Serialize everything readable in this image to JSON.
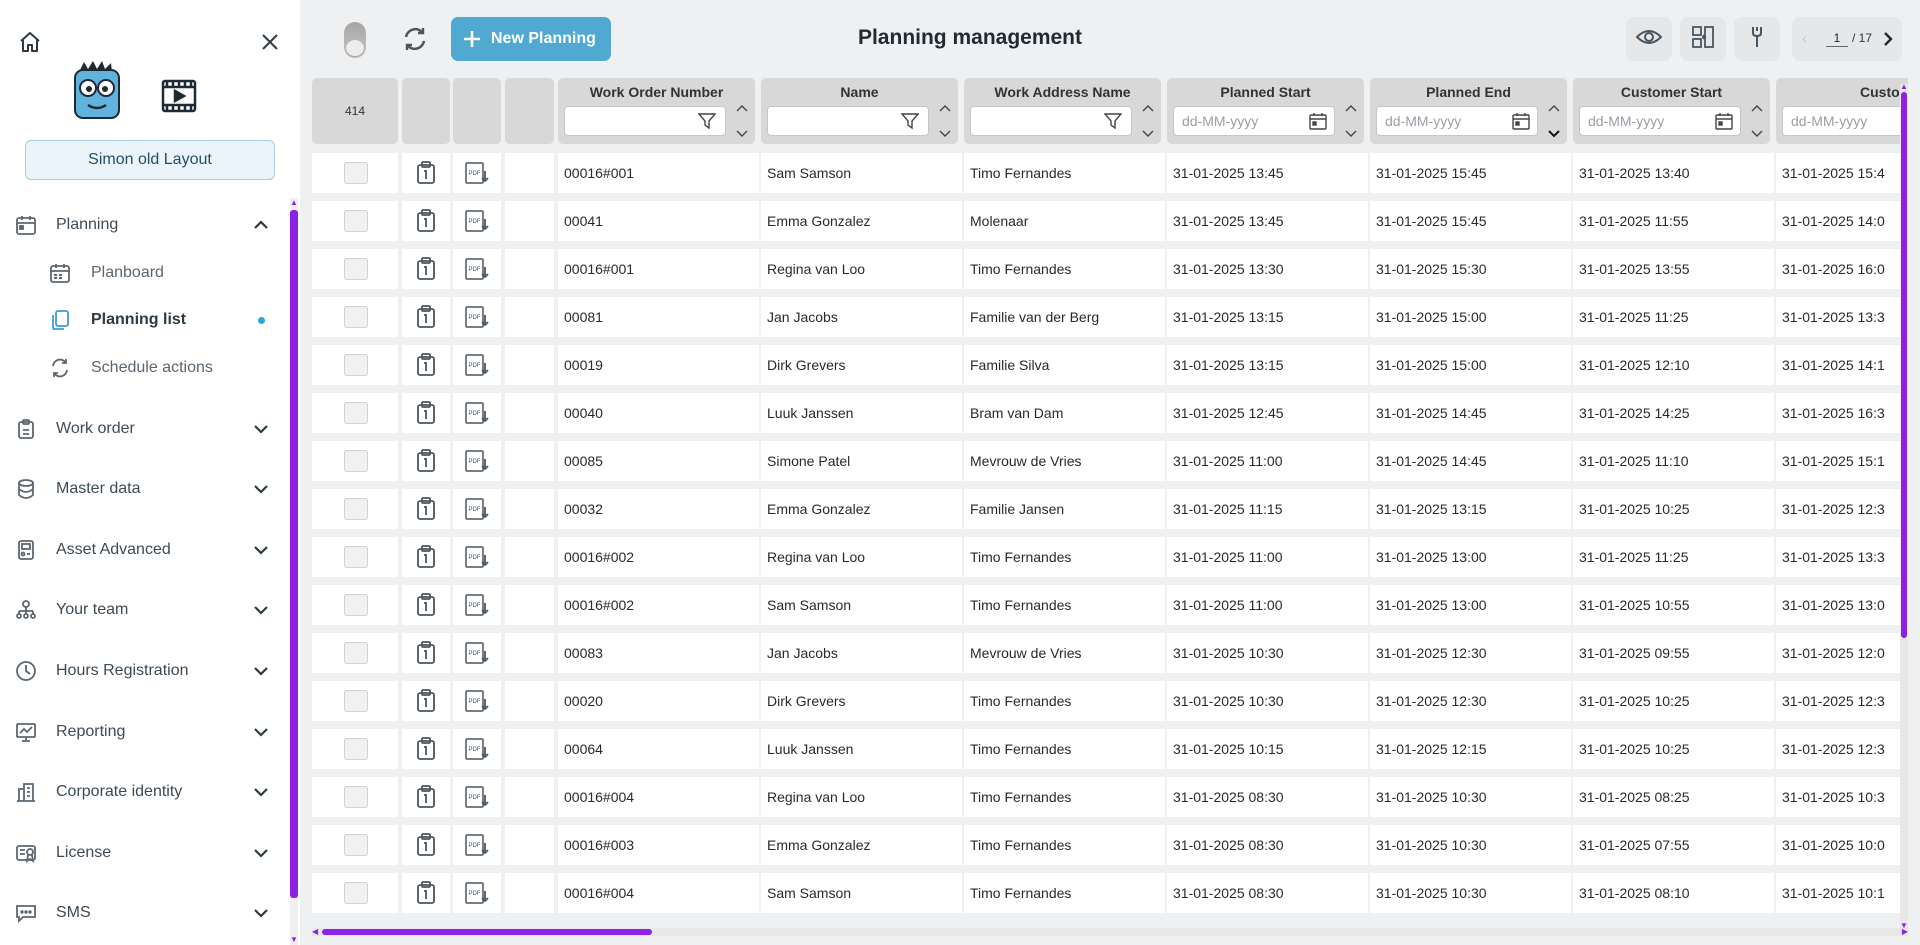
{
  "sidebar": {
    "layout_label": "Simon old Layout",
    "planning": {
      "label": "Planning"
    },
    "sub_items": [
      {
        "label": "Planboard"
      },
      {
        "label": "Planning list"
      },
      {
        "label": "Schedule actions"
      }
    ],
    "items": [
      {
        "label": "Work order",
        "icon": "clipboard-icon"
      },
      {
        "label": "Master data",
        "icon": "database-icon"
      },
      {
        "label": "Asset Advanced",
        "icon": "asset-icon"
      },
      {
        "label": "Your team",
        "icon": "team-icon"
      },
      {
        "label": "Hours Registration",
        "icon": "clock-icon"
      },
      {
        "label": "Reporting",
        "icon": "reporting-icon"
      },
      {
        "label": "Corporate identity",
        "icon": "building-icon"
      },
      {
        "label": "License",
        "icon": "license-icon"
      },
      {
        "label": "SMS",
        "icon": "sms-icon"
      }
    ]
  },
  "toolbar": {
    "new_planning_label": "New Planning",
    "title": "Planning management",
    "pager": {
      "current": "1",
      "total": "/ 17"
    }
  },
  "grid": {
    "record_count": "414",
    "columns": [
      {
        "title": "Work Order Number",
        "placeholder": ""
      },
      {
        "title": "Name",
        "placeholder": ""
      },
      {
        "title": "Work Address Name",
        "placeholder": ""
      },
      {
        "title": "Planned Start",
        "placeholder": "dd-MM-yyyy"
      },
      {
        "title": "Planned End",
        "placeholder": "dd-MM-yyyy"
      },
      {
        "title": "Customer Start",
        "placeholder": "dd-MM-yyyy"
      },
      {
        "title": "Customer",
        "placeholder": "dd-MM-yyyy"
      }
    ],
    "rows": [
      [
        "00016#001",
        "Sam Samson",
        "Timo Fernandes",
        "31-01-2025 13:45",
        "31-01-2025 15:45",
        "31-01-2025 13:40",
        "31-01-2025 15:4"
      ],
      [
        "00041",
        "Emma Gonzalez",
        "Molenaar",
        "31-01-2025 13:45",
        "31-01-2025 15:45",
        "31-01-2025 11:55",
        "31-01-2025 14:0"
      ],
      [
        "00016#001",
        "Regina van Loo",
        "Timo Fernandes",
        "31-01-2025 13:30",
        "31-01-2025 15:30",
        "31-01-2025 13:55",
        "31-01-2025 16:0"
      ],
      [
        "00081",
        "Jan Jacobs",
        "Familie van der Berg",
        "31-01-2025 13:15",
        "31-01-2025 15:00",
        "31-01-2025 11:25",
        "31-01-2025 13:3"
      ],
      [
        "00019",
        "Dirk Grevers",
        "Familie Silva",
        "31-01-2025 13:15",
        "31-01-2025 15:00",
        "31-01-2025 12:10",
        "31-01-2025 14:1"
      ],
      [
        "00040",
        "Luuk Janssen",
        "Bram van Dam",
        "31-01-2025 12:45",
        "31-01-2025 14:45",
        "31-01-2025 14:25",
        "31-01-2025 16:3"
      ],
      [
        "00085",
        "Simone Patel",
        "Mevrouw de Vries",
        "31-01-2025 11:00",
        "31-01-2025 14:45",
        "31-01-2025 11:10",
        "31-01-2025 15:1"
      ],
      [
        "00032",
        "Emma Gonzalez",
        "Familie Jansen",
        "31-01-2025 11:15",
        "31-01-2025 13:15",
        "31-01-2025 10:25",
        "31-01-2025 12:3"
      ],
      [
        "00016#002",
        "Regina van Loo",
        "Timo Fernandes",
        "31-01-2025 11:00",
        "31-01-2025 13:00",
        "31-01-2025 11:25",
        "31-01-2025 13:3"
      ],
      [
        "00016#002",
        "Sam Samson",
        "Timo Fernandes",
        "31-01-2025 11:00",
        "31-01-2025 13:00",
        "31-01-2025 10:55",
        "31-01-2025 13:0"
      ],
      [
        "00083",
        "Jan Jacobs",
        "Mevrouw de Vries",
        "31-01-2025 10:30",
        "31-01-2025 12:30",
        "31-01-2025 09:55",
        "31-01-2025 12:0"
      ],
      [
        "00020",
        "Dirk Grevers",
        "Timo Fernandes",
        "31-01-2025 10:30",
        "31-01-2025 12:30",
        "31-01-2025 10:25",
        "31-01-2025 12:3"
      ],
      [
        "00064",
        "Luuk Janssen",
        "Timo Fernandes",
        "31-01-2025 10:15",
        "31-01-2025 12:15",
        "31-01-2025 10:25",
        "31-01-2025 12:3"
      ],
      [
        "00016#004",
        "Regina van Loo",
        "Timo Fernandes",
        "31-01-2025 08:30",
        "31-01-2025 10:30",
        "31-01-2025 08:25",
        "31-01-2025 10:3"
      ],
      [
        "00016#003",
        "Emma Gonzalez",
        "Timo Fernandes",
        "31-01-2025 08:30",
        "31-01-2025 10:30",
        "31-01-2025 07:55",
        "31-01-2025 10:0"
      ],
      [
        "00016#004",
        "Sam Samson",
        "Timo Fernandes",
        "31-01-2025 08:30",
        "31-01-2025 10:30",
        "31-01-2025 08:10",
        "31-01-2025 10:1"
      ]
    ]
  },
  "colors": {
    "accent": "#4fa9d1",
    "scrollbar": "#8d21e8",
    "active_dot": "#2aa7d8"
  }
}
